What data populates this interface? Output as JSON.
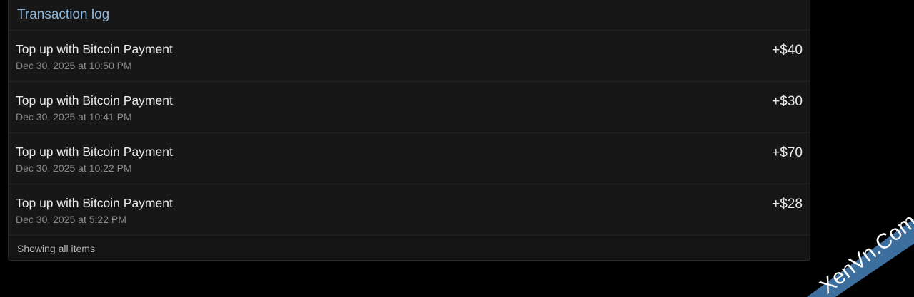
{
  "panel": {
    "title": "Transaction log",
    "footer": "Showing all items"
  },
  "transactions": [
    {
      "title": "Top up with Bitcoin Payment",
      "date": "Dec 30, 2025 at 10:50 PM",
      "amount": "+$40"
    },
    {
      "title": "Top up with Bitcoin Payment",
      "date": "Dec 30, 2025 at 10:41 PM",
      "amount": "+$30"
    },
    {
      "title": "Top up with Bitcoin Payment",
      "date": "Dec 30, 2025 at 10:22 PM",
      "amount": "+$70"
    },
    {
      "title": "Top up with Bitcoin Payment",
      "date": "Dec 30, 2025 at 5:22 PM",
      "amount": "+$28"
    }
  ],
  "watermark": {
    "text": "XenVn.Com",
    "color": "#3d6f9e"
  },
  "colors": {
    "background": "#000000",
    "panel": "#171717",
    "title": "#8fb7d9"
  }
}
